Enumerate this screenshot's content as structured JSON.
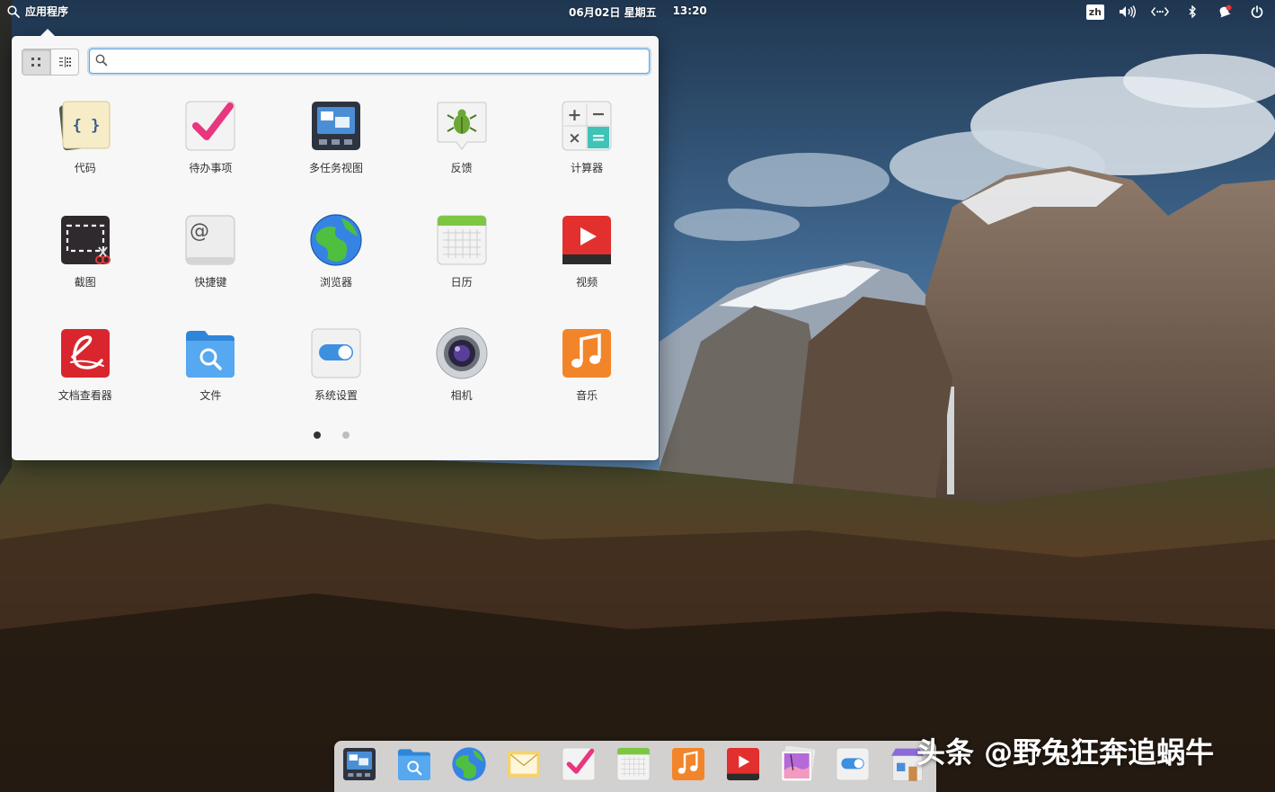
{
  "panel": {
    "apps_label": "应用程序",
    "date": "06月02日 星期五",
    "time": "13:20",
    "lang": "zh"
  },
  "launcher": {
    "search": {
      "value": "",
      "placeholder": ""
    },
    "apps": [
      {
        "label": "代码",
        "icon": "code-editor-icon"
      },
      {
        "label": "待办事项",
        "icon": "tasks-icon"
      },
      {
        "label": "多任务视图",
        "icon": "multitasking-view-icon"
      },
      {
        "label": "反馈",
        "icon": "feedback-icon"
      },
      {
        "label": "计算器",
        "icon": "calculator-icon"
      },
      {
        "label": "截图",
        "icon": "screenshot-icon"
      },
      {
        "label": "快捷键",
        "icon": "keyboard-shortcuts-icon"
      },
      {
        "label": "浏览器",
        "icon": "web-browser-icon"
      },
      {
        "label": "日历",
        "icon": "calendar-icon"
      },
      {
        "label": "视频",
        "icon": "videos-icon"
      },
      {
        "label": "文档查看器",
        "icon": "document-viewer-icon"
      },
      {
        "label": "文件",
        "icon": "files-icon"
      },
      {
        "label": "系统设置",
        "icon": "system-settings-icon"
      },
      {
        "label": "相机",
        "icon": "camera-icon"
      },
      {
        "label": "音乐",
        "icon": "music-icon"
      }
    ],
    "pages": 2,
    "current_page": 1
  },
  "dock": [
    {
      "icon": "multitasking-view-icon"
    },
    {
      "icon": "files-icon"
    },
    {
      "icon": "web-browser-icon"
    },
    {
      "icon": "mail-icon"
    },
    {
      "icon": "tasks-icon"
    },
    {
      "icon": "calendar-icon"
    },
    {
      "icon": "music-icon"
    },
    {
      "icon": "videos-icon"
    },
    {
      "icon": "photos-icon"
    },
    {
      "icon": "system-settings-icon"
    },
    {
      "icon": "app-center-icon"
    }
  ],
  "watermark": "头条 @野兔狂奔追蜗牛"
}
